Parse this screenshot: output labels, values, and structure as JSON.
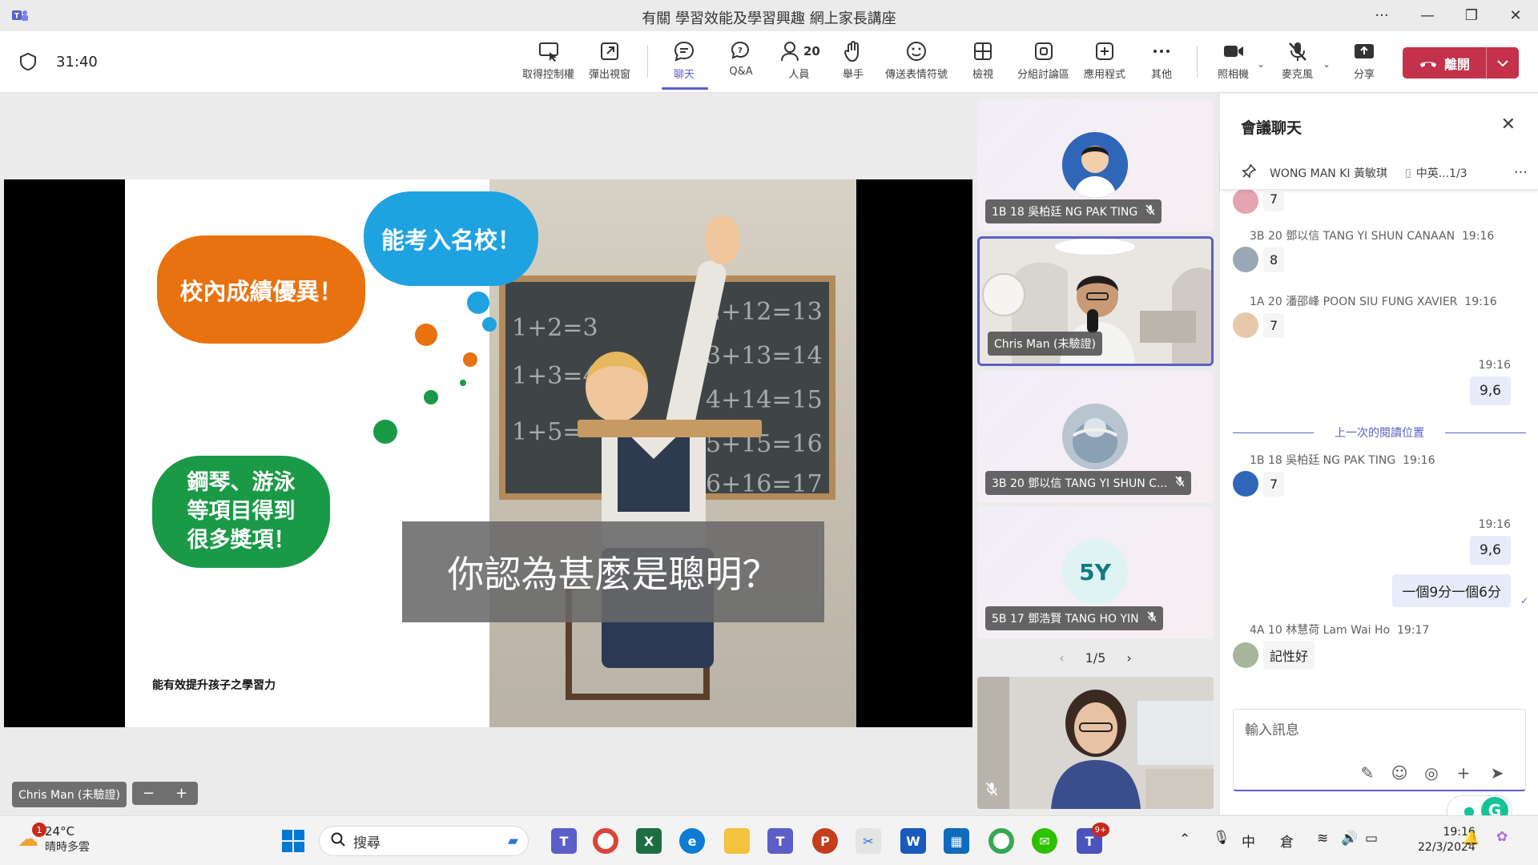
{
  "window": {
    "title": "有關 學習效能及學習興趣 網上家長講座"
  },
  "toolbar": {
    "timer": "31:40",
    "buttons": [
      {
        "id": "control",
        "label": "取得控制權"
      },
      {
        "id": "popout",
        "label": "彈出視窗"
      },
      {
        "id": "chat",
        "label": "聊天"
      },
      {
        "id": "qa",
        "label": "Q&A"
      },
      {
        "id": "people",
        "label": "人員",
        "count": "20"
      },
      {
        "id": "raise",
        "label": "舉手"
      },
      {
        "id": "react",
        "label": "傳送表情符號"
      },
      {
        "id": "view",
        "label": "檢視"
      },
      {
        "id": "rooms",
        "label": "分組討論區"
      },
      {
        "id": "apps",
        "label": "應用程式"
      },
      {
        "id": "more",
        "label": "其他"
      },
      {
        "id": "camera",
        "label": "照相機"
      },
      {
        "id": "mic",
        "label": "麥克風"
      },
      {
        "id": "share",
        "label": "分享"
      }
    ],
    "leave_label": "離開"
  },
  "slide": {
    "cloud_orange": "校內成績優異！",
    "cloud_blue": "能考入名校！",
    "cloud_green": "鋼琴、游泳\n等項目得到\n很多獎項！",
    "question": "你認為甚麼是聰明？",
    "footer": "能有效提升孩子之學習力",
    "chalk": [
      "1+2=3",
      "1+3=4",
      "1+5=",
      "2+12=13",
      "3+13=14",
      "4+14=15",
      "5+15=16",
      "6+16=17"
    ]
  },
  "stage": {
    "presenter": "Chris Man (未驗證)",
    "zoom_minus": "−",
    "zoom_plus": "+"
  },
  "tiles": [
    {
      "name": "1B 18 吳柏廷 NG PAK TING",
      "muted": true
    },
    {
      "name": "Chris Man (未驗證)",
      "muted": false
    },
    {
      "name": "3B 20 鄧以信 TANG YI SHUN C...",
      "muted": true
    },
    {
      "name": "5B 17 鄧浩賢 TANG HO YIN",
      "initials": "5Y",
      "muted": true
    }
  ],
  "pager": {
    "text": "1/5"
  },
  "chat": {
    "title": "會議聊天",
    "pinned_name": "WONG MAN KI 黃敏琪",
    "pinned_file": "中英...1/3",
    "partial_top": "7",
    "messages": [
      {
        "sender": "3B 20 鄧以信 TANG YI SHUN CANAAN",
        "time": "19:16",
        "text": "8"
      },
      {
        "sender": "1A 20 潘邵峰 POON SIU FUNG XAVIER",
        "time": "19:16",
        "text": "7"
      },
      {
        "mine": true,
        "time": "19:16",
        "text": "9,6"
      },
      {
        "sender": "1B 18 吳柏廷 NG PAK TING",
        "time": "19:16",
        "text": "7"
      },
      {
        "mine": true,
        "time": "19:16",
        "text": "9,6"
      },
      {
        "mine": true,
        "text": "一個9分一個6分"
      },
      {
        "sender": "4A 10 林慧荷 Lam Wai Ho",
        "time": "19:17",
        "text": "記性好"
      }
    ],
    "last_read": "上一次的閱讀位置",
    "composer_placeholder": "輸入訊息"
  },
  "taskbar": {
    "weather_temp": "24°C",
    "weather_cond": "晴時多雲",
    "weather_badge": "1",
    "search_label": "搜尋",
    "teams_badge": "9+",
    "ime_1": "中",
    "ime_2": "倉",
    "time": "19:16",
    "date": "22/3/2024"
  },
  "colors": {
    "accent": "#5b5fc7",
    "leave": "#c4314b",
    "orange": "#e8720f",
    "blue": "#1fa2e0",
    "green": "#1a9a47"
  }
}
